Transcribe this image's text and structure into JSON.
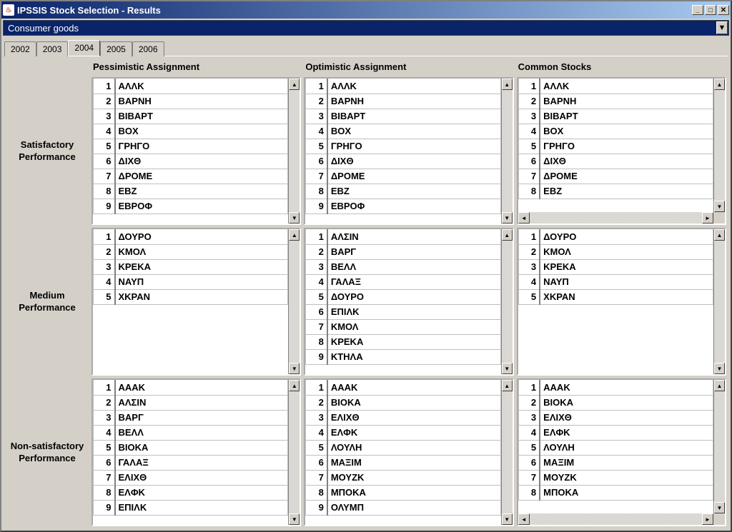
{
  "window": {
    "title": "IPSSIS Stock Selection - Results"
  },
  "dropdown": {
    "selected": "Consumer goods"
  },
  "tabs": [
    "2002",
    "2003",
    "2004",
    "2005",
    "2006"
  ],
  "active_tab": "2004",
  "columns": [
    "Pessimistic Assignment",
    "Optimistic Assignment",
    "Common Stocks"
  ],
  "rows": [
    "Satisfactory Performance",
    "Medium Performance",
    "Non-satisfactory Performance"
  ],
  "lists": {
    "satisfactory": {
      "pessimistic": [
        "ΑΛΛΚ",
        "ΒΑΡΝΗ",
        "ΒΙΒΑΡΤ",
        "ΒΟΧ",
        "ΓΡΗΓΟ",
        "ΔΙΧΘ",
        "ΔΡΟΜΕ",
        "ΕΒΖ",
        "ΕΒΡΟΦ"
      ],
      "optimistic": [
        "ΑΛΛΚ",
        "ΒΑΡΝΗ",
        "ΒΙΒΑΡΤ",
        "ΒΟΧ",
        "ΓΡΗΓΟ",
        "ΔΙΧΘ",
        "ΔΡΟΜΕ",
        "ΕΒΖ",
        "ΕΒΡΟΦ"
      ],
      "common": [
        "ΑΛΛΚ",
        "ΒΑΡΝΗ",
        "ΒΙΒΑΡΤ",
        "ΒΟΧ",
        "ΓΡΗΓΟ",
        "ΔΙΧΘ",
        "ΔΡΟΜΕ",
        "ΕΒΖ"
      ]
    },
    "medium": {
      "pessimistic": [
        "ΔΟΥΡΟ",
        "ΚΜΟΛ",
        "ΚΡΕΚΑ",
        "ΝΑΥΠ",
        "ΧΚΡΑΝ"
      ],
      "optimistic": [
        "ΑΛΣΙΝ",
        "ΒΑΡΓ",
        "ΒΕΛΛ",
        "ΓΑΛΑΞ",
        "ΔΟΥΡΟ",
        "ΕΠΙΛΚ",
        "ΚΜΟΛ",
        "ΚΡΕΚΑ",
        "ΚΤΗΛΑ"
      ],
      "common": [
        "ΔΟΥΡΟ",
        "ΚΜΟΛ",
        "ΚΡΕΚΑ",
        "ΝΑΥΠ",
        "ΧΚΡΑΝ"
      ]
    },
    "nonsatisfactory": {
      "pessimistic": [
        "ΑΑΑΚ",
        "ΑΛΣΙΝ",
        "ΒΑΡΓ",
        "ΒΕΛΛ",
        "ΒΙΟΚΑ",
        "ΓΑΛΑΞ",
        "ΕΛΙΧΘ",
        "ΕΛΦΚ",
        "ΕΠΙΛΚ"
      ],
      "optimistic": [
        "ΑΑΑΚ",
        "ΒΙΟΚΑ",
        "ΕΛΙΧΘ",
        "ΕΛΦΚ",
        "ΛΟΥΛΗ",
        "ΜΑΞΙΜ",
        "ΜΟΥΖΚ",
        "ΜΠΟΚΑ",
        "ΟΛΥΜΠ"
      ],
      "common": [
        "ΑΑΑΚ",
        "ΒΙΟΚΑ",
        "ΕΛΙΧΘ",
        "ΕΛΦΚ",
        "ΛΟΥΛΗ",
        "ΜΑΞΙΜ",
        "ΜΟΥΖΚ",
        "ΜΠΟΚΑ"
      ]
    }
  }
}
